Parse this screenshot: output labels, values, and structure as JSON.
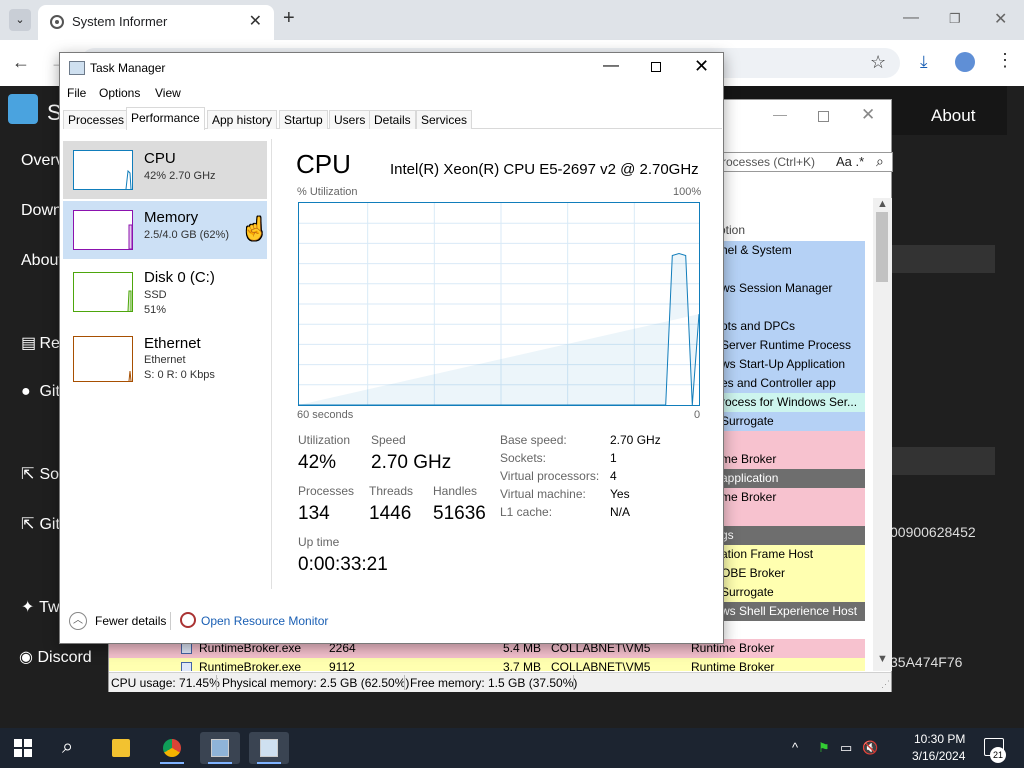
{
  "browser": {
    "tab_title": "System Informer",
    "tab_close": "✕",
    "new_tab": "+",
    "search_tabs": "⌄",
    "min": "—",
    "max": "❐",
    "close": "✕",
    "back": "←",
    "forward": "→",
    "star": "☆",
    "download": "⤓",
    "menu": "⋮"
  },
  "site": {
    "brand_letter": "S",
    "about": "About",
    "nav": [
      "Overv",
      "Down",
      "About",
      "Rea",
      "Git",
      "So",
      "Git",
      "Tw",
      "Discord"
    ],
    "hex1": "00900628452",
    "hex2": "35A474F76"
  },
  "system_informer": {
    "min": "—",
    "close": "✕",
    "search_placeholder": "rocesses (Ctrl+K)",
    "search_aa": "Aa .*",
    "search_glass": "⌕",
    "desc_header": "otion",
    "rows": [
      {
        "text": "nel & System",
        "color": "blue"
      },
      {
        "text": "",
        "color": "blue"
      },
      {
        "text": "ws Session Manager",
        "color": "blue"
      },
      {
        "text": "",
        "color": "blue"
      },
      {
        "text": "pts and DPCs",
        "color": "blue"
      },
      {
        "text": "Server Runtime Process",
        "color": "blue"
      },
      {
        "text": "ws Start-Up Application",
        "color": "blue"
      },
      {
        "text": "es and Controller app",
        "color": "blue"
      },
      {
        "text": "rocess for Windows Ser...",
        "color": "cyan"
      },
      {
        "text": "Surrogate",
        "color": "blue"
      },
      {
        "text": "",
        "color": "pink"
      },
      {
        "text": "me Broker",
        "color": "pink"
      },
      {
        "text": "application",
        "color": "gray"
      },
      {
        "text": "me Broker",
        "color": "pink"
      },
      {
        "text": "",
        "color": "pink"
      },
      {
        "text": "gs",
        "color": "gray"
      },
      {
        "text": "ation Frame Host",
        "color": "yellow"
      },
      {
        "text": "OBE Broker",
        "color": "yellow"
      },
      {
        "text": "Surrogate",
        "color": "yellow"
      },
      {
        "text": "ws Shell Experience Host",
        "color": "gray"
      }
    ],
    "full_rows": [
      {
        "name": "RuntimeBroker.exe",
        "pid": "2264",
        "mem": "5.4 MB",
        "user": "COLLABNET\\VM5",
        "desc": "Runtime Broker",
        "color": "pink"
      },
      {
        "name": "RuntimeBroker.exe",
        "pid": "9112",
        "mem": "3.7 MB",
        "user": "COLLABNET\\VM5",
        "desc": "Runtime Broker",
        "color": "yellow"
      }
    ],
    "scroll_up": "▲",
    "scroll_down": "▼",
    "status": {
      "cpu": "CPU usage: 71.45%",
      "physical": "Physical memory: 2.5 GB (62.50%)",
      "free": "Free memory: 1.5 GB (37.50%)"
    }
  },
  "task_manager": {
    "title": "Task Manager",
    "min": "—",
    "close": "✕",
    "menu": [
      "File",
      "Options",
      "View"
    ],
    "tabs": [
      "Processes",
      "Performance",
      "App history",
      "Startup",
      "Users",
      "Details",
      "Services"
    ],
    "active_tab": "Performance",
    "perf_items": [
      {
        "name": "CPU",
        "line1": "42% 2.70 GHz",
        "line2": "",
        "color": "#117dbb"
      },
      {
        "name": "Memory",
        "line1": "2.5/4.0 GB (62%)",
        "line2": "",
        "color": "#8b12ae"
      },
      {
        "name": "Disk 0 (C:)",
        "line1": "SSD",
        "line2": "51%",
        "color": "#4da60c"
      },
      {
        "name": "Ethernet",
        "line1": "Ethernet",
        "line2": "S: 0 R: 0 Kbps",
        "color": "#a74f01"
      }
    ],
    "cpu": {
      "heading": "CPU",
      "model": "Intel(R) Xeon(R) CPU E5-2697 v2 @ 2.70GHz",
      "util_label": "% Utilization",
      "util_max": "100%",
      "time_left": "60 seconds",
      "time_right": "0",
      "stats": {
        "utilization_label": "Utilization",
        "utilization": "42%",
        "speed_label": "Speed",
        "speed": "2.70 GHz",
        "processes_label": "Processes",
        "processes": "134",
        "threads_label": "Threads",
        "threads": "1446",
        "handles_label": "Handles",
        "handles": "51636",
        "uptime_label": "Up time",
        "uptime": "0:00:33:21"
      },
      "specs": [
        {
          "label": "Base speed:",
          "value": "2.70 GHz"
        },
        {
          "label": "Sockets:",
          "value": "1"
        },
        {
          "label": "Virtual processors:",
          "value": "4"
        },
        {
          "label": "Virtual machine:",
          "value": "Yes"
        },
        {
          "label": "L1 cache:",
          "value": "N/A"
        }
      ]
    },
    "footer": {
      "fewer": "Fewer details",
      "fewer_icon": "︿",
      "monitor": "Open Resource Monitor"
    }
  },
  "chart_data": {
    "type": "line",
    "title": "",
    "xlabel": "60 seconds",
    "ylabel": "% Utilization",
    "ylim": [
      0,
      100
    ],
    "x_range": [
      60,
      0
    ],
    "grid": true,
    "series": [
      {
        "x": [
          60,
          5,
          4,
          3,
          2,
          1,
          0
        ],
        "values": [
          0,
          0,
          74,
          75,
          74,
          0,
          45
        ]
      }
    ]
  },
  "taskbar": {
    "search_icon": "⌕",
    "time": "10:30 PM",
    "date": "3/16/2024",
    "notif_count": "21",
    "tray": [
      "^",
      "⚑",
      "▭",
      "🔇"
    ]
  }
}
